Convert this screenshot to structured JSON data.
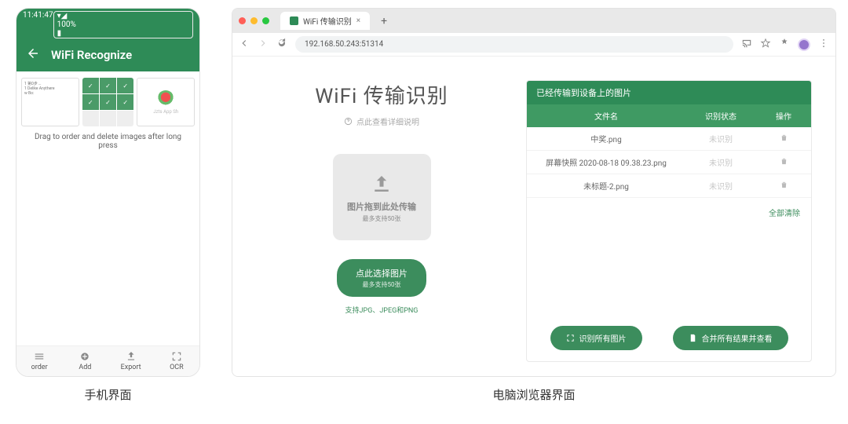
{
  "phone": {
    "status": {
      "time": "11:41:47",
      "battery": "100%"
    },
    "appbar": {
      "title": "WiFi Recognize"
    },
    "thumb3_label": "Jzts App Sh",
    "hint": "Drag to order and delete images after long press",
    "bottom": [
      {
        "id": "order",
        "label": "order"
      },
      {
        "id": "add",
        "label": "Add"
      },
      {
        "id": "export",
        "label": "Export"
      },
      {
        "id": "ocr",
        "label": "OCR"
      }
    ],
    "caption": "手机界面"
  },
  "browser": {
    "tab_title": "WiFi 传输识别",
    "url": "192.168.50.243:51314",
    "page": {
      "title": "WiFi 传输识别",
      "subtitle": "点此查看详细说明",
      "drop_main": "图片拖到此处传输",
      "drop_sub": "最多支持50张",
      "pick_main": "点此选择图片",
      "pick_sub": "最多支持50张",
      "support": "支持JPG、JPEG和PNG"
    },
    "panel": {
      "header": "已经传输到设备上的图片",
      "cols": {
        "name": "文件名",
        "status": "识别状态",
        "op": "操作"
      },
      "rows": [
        {
          "name": "中奖.png",
          "status": "未识别"
        },
        {
          "name": "屏幕快照 2020-08-18 09.38.23.png",
          "status": "未识别"
        },
        {
          "name": "未标题-2.png",
          "status": "未识别"
        }
      ],
      "clear_all": "全部清除",
      "btn_recognize": "识别所有图片",
      "btn_merge": "合并所有结果并查看"
    },
    "caption": "电脑浏览器界面"
  }
}
